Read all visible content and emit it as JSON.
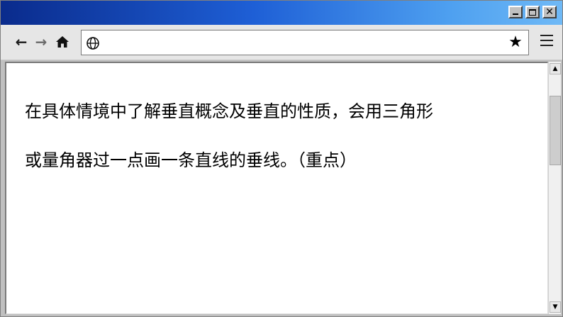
{
  "window": {
    "controls": {
      "minimize": "",
      "maximize": "",
      "close": "✕"
    }
  },
  "toolbar": {
    "back_icon": "←",
    "forward_icon": "→",
    "home_icon": "home-icon",
    "address": {
      "value": "",
      "placeholder": ""
    },
    "bookmark_icon": "★",
    "menu_icon": "hamburger-menu-icon"
  },
  "content": {
    "lines": [
      "在具体情境中了解垂直概念及垂直的性质，会用三角形",
      "或量角器过一点画一条直线的垂线。（重点）"
    ]
  },
  "scrollbar": {
    "up_arrow": "▲",
    "down_arrow": "▼",
    "position": 0.12
  },
  "colors": {
    "titlebar_start": "#0a2b8c",
    "titlebar_end": "#6fb9f6",
    "chrome": "#c0c0c0",
    "toolbar": "#e6e6e6"
  }
}
